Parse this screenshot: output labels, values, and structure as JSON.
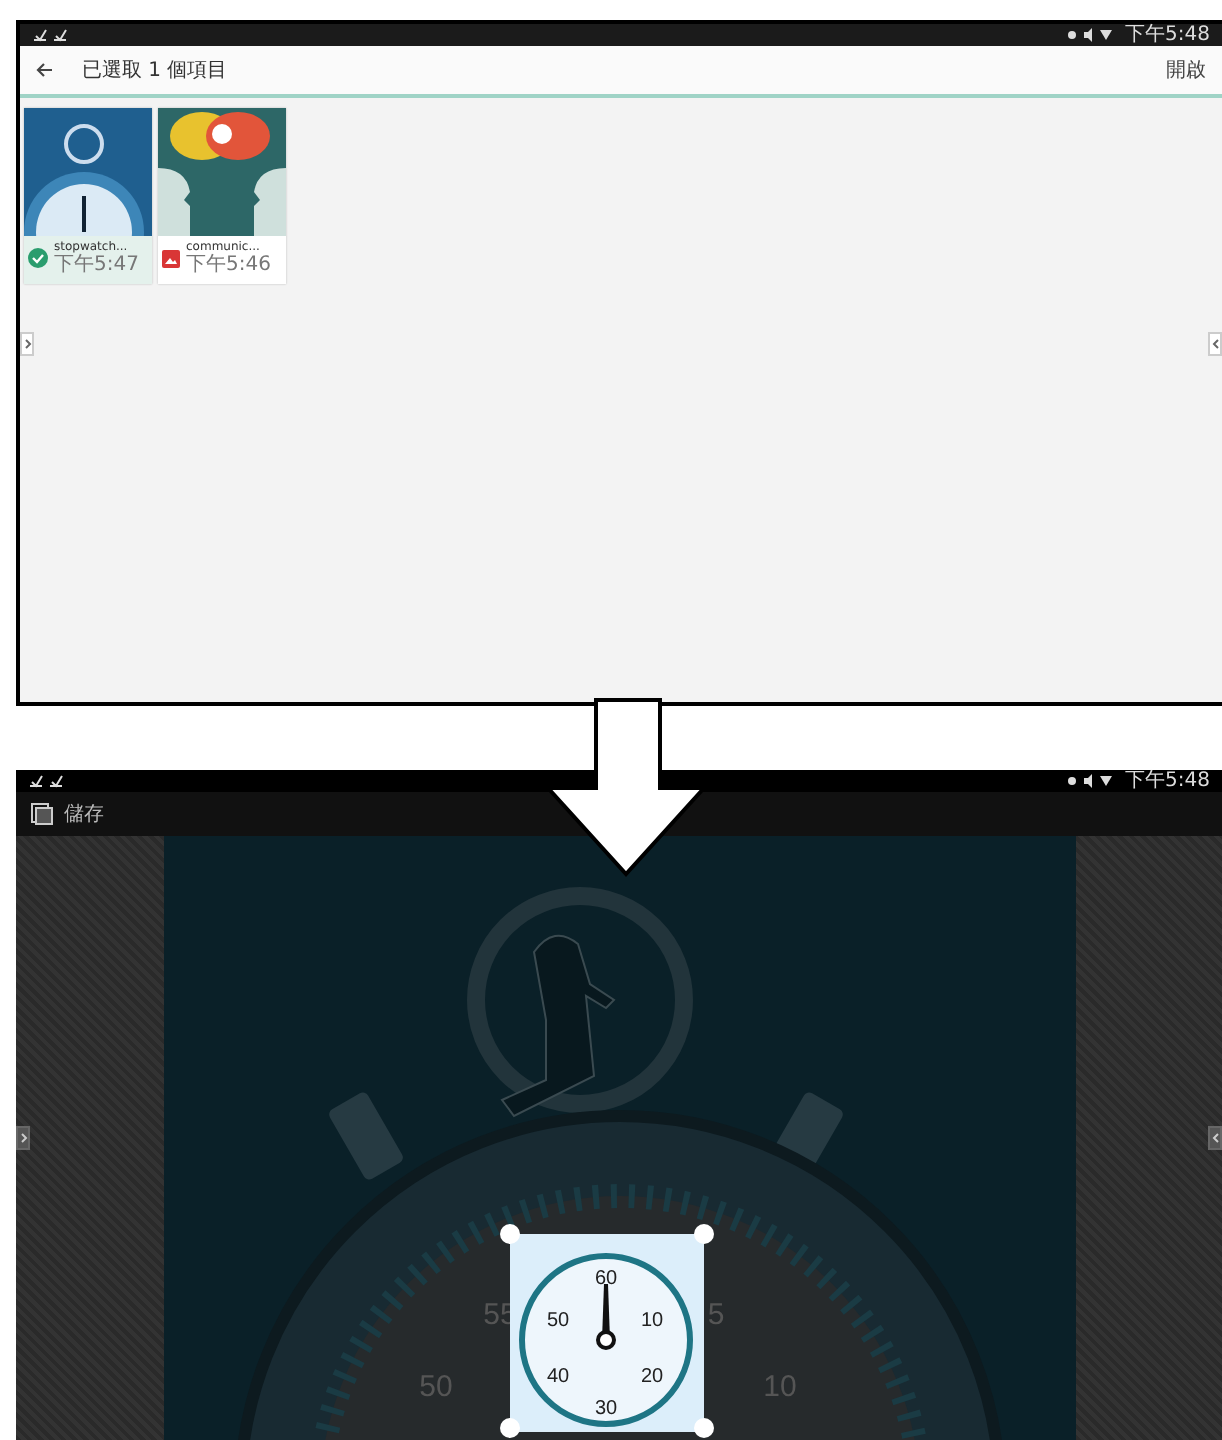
{
  "top_screen": {
    "status_time": "下午5:48",
    "title": "已選取 1 個項目",
    "action": "開啟"
  },
  "files": [
    {
      "name": "stopwatch...",
      "time": "下午5:47",
      "selected": true
    },
    {
      "name": "communic...",
      "time": "下午5:46",
      "selected": false
    }
  ],
  "editor": {
    "status_time": "下午5:48",
    "save_label": "儲存",
    "dial_labels": [
      "55",
      "5",
      "50",
      "10"
    ],
    "crop_dial_labels": [
      "60",
      "50",
      "10",
      "40",
      "20",
      "30"
    ]
  }
}
